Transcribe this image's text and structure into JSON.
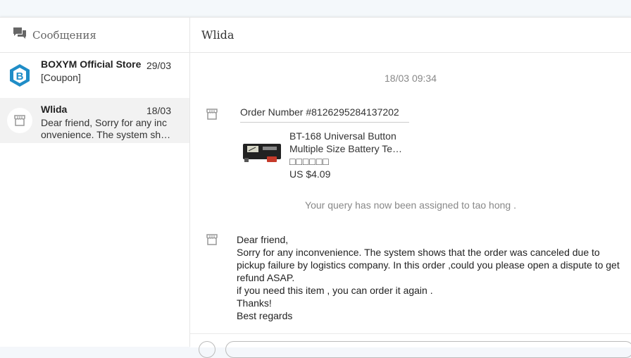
{
  "sidebar": {
    "title": "Сообщения",
    "conversations": [
      {
        "name": "BOXYM Official Store",
        "date": "29/03",
        "preview": "[Coupon]"
      },
      {
        "name": "Wlida",
        "date": "18/03",
        "preview_line1": "Dear friend, Sorry for any inc",
        "preview_line2": "onvenience. The system sh…"
      }
    ]
  },
  "chat": {
    "title": "Wlida",
    "timestamp": "18/03 09:34",
    "order": {
      "number": "Order Number #8126295284137202",
      "product_line1": "BT-168 Universal Button",
      "product_line2": "Multiple Size Battery Te…",
      "product_line3": "□□□□□□",
      "price": "US $4.09"
    },
    "notice": "Your query has now been assigned to tao hong .",
    "message": {
      "l1": "Dear friend,",
      "l2": "Sorry for any inconvenience. The system shows that the order was canceled due to",
      "l3": "pickup failure by logistics company. In this order ,could you please open a dispute to get",
      "l4": "refund ASAP.",
      "l5": "if you need this item , you can order it again .",
      "l6": "Thanks!",
      "l7": "Best regards"
    }
  },
  "colors": {
    "brand_blue": "#1f8dc7",
    "muted_text": "#888888",
    "active_row": "#f2f2f2"
  }
}
